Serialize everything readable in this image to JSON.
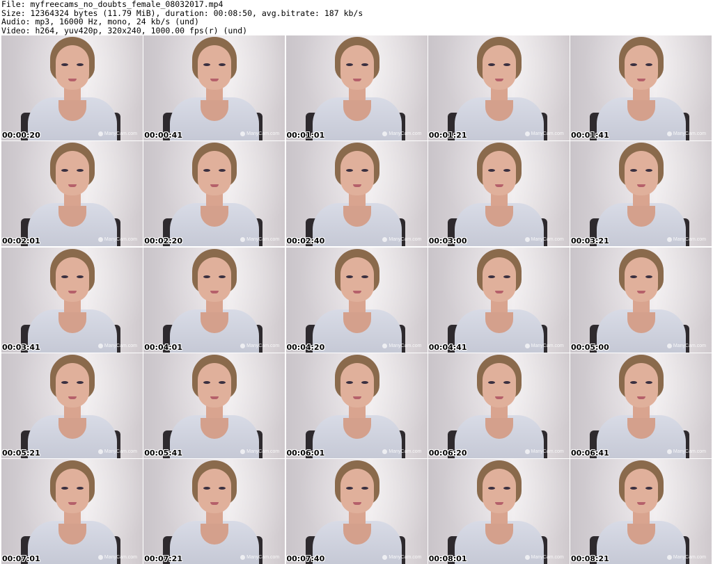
{
  "header": {
    "file_line": "File: myfreecams_no_doubts_female_08032017.mp4",
    "size_line": "Size: 12364324 bytes (11.79 MiB), duration: 00:08:50, avg.bitrate: 187 kb/s",
    "audio_line": "Audio: mp3, 16000 Hz, mono, 24 kb/s (und)",
    "video_line": "Video: h264, yuv420p, 320x240, 1000.00 fps(r) (und)"
  },
  "watermark_text": "ManyCam.com",
  "thumbnails": [
    {
      "time": "00:00:20"
    },
    {
      "time": "00:00:41"
    },
    {
      "time": "00:01:01"
    },
    {
      "time": "00:01:21"
    },
    {
      "time": "00:01:41"
    },
    {
      "time": "00:02:01"
    },
    {
      "time": "00:02:20"
    },
    {
      "time": "00:02:40"
    },
    {
      "time": "00:03:00"
    },
    {
      "time": "00:03:21"
    },
    {
      "time": "00:03:41"
    },
    {
      "time": "00:04:01"
    },
    {
      "time": "00:04:20"
    },
    {
      "time": "00:04:41"
    },
    {
      "time": "00:05:00"
    },
    {
      "time": "00:05:21"
    },
    {
      "time": "00:05:41"
    },
    {
      "time": "00:06:01"
    },
    {
      "time": "00:06:20"
    },
    {
      "time": "00:06:41"
    },
    {
      "time": "00:07:01"
    },
    {
      "time": "00:07:21"
    },
    {
      "time": "00:07:40"
    },
    {
      "time": "00:08:01"
    },
    {
      "time": "00:08:21"
    }
  ],
  "colors": {
    "background": "#ffffff",
    "text": "#000000"
  }
}
